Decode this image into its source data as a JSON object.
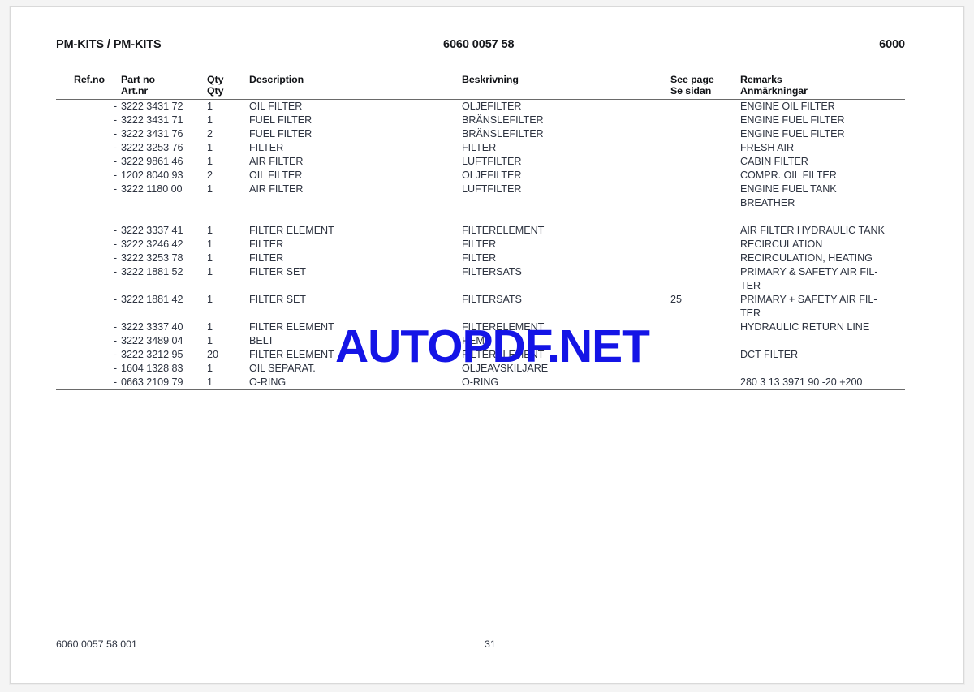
{
  "document": {
    "header": {
      "left_title": "PM-KITS / PM-KITS",
      "center_number": "6060 0057 58",
      "right_number": "6000"
    },
    "footer": {
      "left_code": "6060 0057 58 001",
      "page_number": "31"
    },
    "watermark": {
      "text": "AUTOPDF.NET",
      "color": "#1414e6"
    },
    "table": {
      "columns": {
        "ref_no": {
          "line1": "Ref.no",
          "line2": ""
        },
        "part_no": {
          "line1": "Part no",
          "line2": "Art.nr"
        },
        "qty": {
          "line1": "Qty",
          "line2": "Qty"
        },
        "description": {
          "line1": "Description",
          "line2": ""
        },
        "beskrivning": {
          "line1": "Beskrivning",
          "line2": ""
        },
        "see_page": {
          "line1": "See page",
          "line2": "Se sidan"
        },
        "remarks": {
          "line1": "Remarks",
          "line2": "Anmärkningar"
        }
      },
      "rows": [
        {
          "ref": "-",
          "part": "3222 3431 72",
          "qty": "1",
          "desc": "OIL FILTER",
          "besk": "OLJEFILTER",
          "page": "",
          "rem": "ENGINE OIL FILTER"
        },
        {
          "ref": "-",
          "part": "3222 3431 71",
          "qty": "1",
          "desc": "FUEL FILTER",
          "besk": "BRÄNSLEFILTER",
          "page": "",
          "rem": "ENGINE FUEL FILTER"
        },
        {
          "ref": "-",
          "part": "3222 3431 76",
          "qty": "2",
          "desc": "FUEL FILTER",
          "besk": "BRÄNSLEFILTER",
          "page": "",
          "rem": "ENGINE FUEL FILTER"
        },
        {
          "ref": "-",
          "part": "3222 3253 76",
          "qty": "1",
          "desc": "FILTER",
          "besk": "FILTER",
          "page": "",
          "rem": "FRESH AIR"
        },
        {
          "ref": "-",
          "part": "3222 9861 46",
          "qty": "1",
          "desc": "AIR FILTER",
          "besk": "LUFTFILTER",
          "page": "",
          "rem": "CABIN FILTER"
        },
        {
          "ref": "-",
          "part": "1202 8040 93",
          "qty": "2",
          "desc": "OIL FILTER",
          "besk": "OLJEFILTER",
          "page": "",
          "rem": "COMPR. OIL FILTER"
        },
        {
          "ref": "-",
          "part": "3222 1180 00",
          "qty": "1",
          "desc": "AIR FILTER",
          "besk": "LUFTFILTER",
          "page": "",
          "rem": "ENGINE FUEL TANK"
        },
        {
          "ref": "",
          "part": "",
          "qty": "",
          "desc": "",
          "besk": "",
          "page": "",
          "rem": "BREATHER"
        },
        {
          "ref": "",
          "part": "",
          "qty": "",
          "desc": "",
          "besk": "",
          "page": "",
          "rem": ""
        },
        {
          "ref": "-",
          "part": "3222 3337 41",
          "qty": "1",
          "desc": "FILTER ELEMENT",
          "besk": "FILTERELEMENT",
          "page": "",
          "rem": "AIR FILTER HYDRAULIC TANK"
        },
        {
          "ref": "-",
          "part": "3222 3246 42",
          "qty": "1",
          "desc": "FILTER",
          "besk": "FILTER",
          "page": "",
          "rem": "RECIRCULATION"
        },
        {
          "ref": "-",
          "part": "3222 3253 78",
          "qty": "1",
          "desc": "FILTER",
          "besk": "FILTER",
          "page": "",
          "rem": "RECIRCULATION, HEATING"
        },
        {
          "ref": "-",
          "part": "3222 1881 52",
          "qty": "1",
          "desc": "FILTER SET",
          "besk": "FILTERSATS",
          "page": "",
          "rem": "PRIMARY & SAFETY AIR FIL-"
        },
        {
          "ref": "",
          "part": "",
          "qty": "",
          "desc": "",
          "besk": "",
          "page": "",
          "rem": "TER"
        },
        {
          "ref": "-",
          "part": "3222 1881 42",
          "qty": "1",
          "desc": "FILTER SET",
          "besk": "FILTERSATS",
          "page": "25",
          "rem": "PRIMARY + SAFETY AIR FIL-"
        },
        {
          "ref": "",
          "part": "",
          "qty": "",
          "desc": "",
          "besk": "",
          "page": "",
          "rem": "TER"
        },
        {
          "ref": "-",
          "part": "3222 3337 40",
          "qty": "1",
          "desc": "FILTER ELEMENT",
          "besk": "FILTERELEMENT",
          "page": "",
          "rem": "HYDRAULIC RETURN LINE"
        },
        {
          "ref": "-",
          "part": "3222 3489 04",
          "qty": "1",
          "desc": "BELT",
          "besk": "REM",
          "page": "",
          "rem": ""
        },
        {
          "ref": "-",
          "part": "3222 3212 95",
          "qty": "20",
          "desc": "FILTER ELEMENT",
          "besk": "FILTERELEMENT",
          "page": "",
          "rem": "DCT FILTER"
        },
        {
          "ref": "-",
          "part": "1604 1328 83",
          "qty": "1",
          "desc": "OIL SEPARAT.",
          "besk": "OLJEAVSKILJARE",
          "page": "",
          "rem": ""
        },
        {
          "ref": "-",
          "part": "0663 2109 79",
          "qty": "1",
          "desc": "O-RING",
          "besk": "O-RING",
          "page": "",
          "rem": "280 3 13 3971 90 -20 +200"
        }
      ]
    }
  }
}
